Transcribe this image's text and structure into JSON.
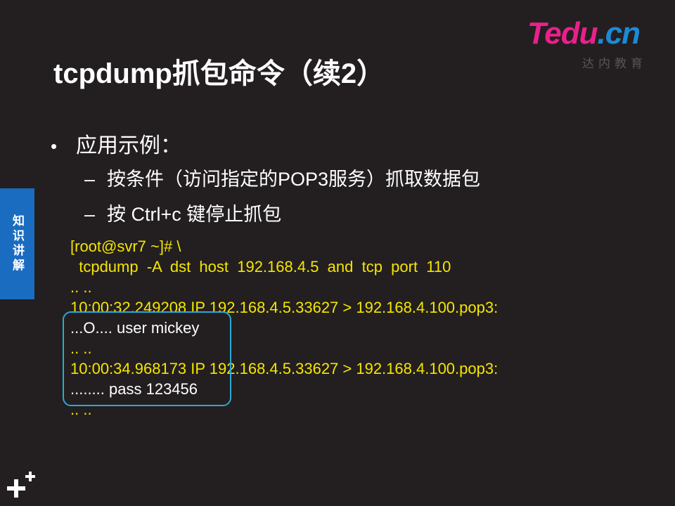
{
  "logo": {
    "brand": "Tedu",
    "tld": ".cn",
    "subtitle": "达内教育"
  },
  "slide": {
    "title": "tcpdump抓包命令（续2）",
    "side_tab_label": "知识讲解",
    "bullets": [
      {
        "marker": "•",
        "text": "应用示例：",
        "children": [
          {
            "marker": "–",
            "text": "按条件（访问指定的POP3服务）抓取数据包"
          },
          {
            "marker": "–",
            "text": "按 Ctrl+c 键停止抓包"
          }
        ]
      }
    ],
    "terminal_lines": [
      {
        "text": "[root@svr7 ~]# \\",
        "color": "#f5e600"
      },
      {
        "text": "  tcpdump  -A  dst  host  192.168.4.5  and  tcp  port  110",
        "color": "#f5e600"
      },
      {
        "text": ".. ..",
        "color": "#f5e600"
      },
      {
        "text": "10:00:32.249208 IP 192.168.4.5.33627 > 192.168.4.100.pop3:",
        "color": "#f5e600"
      },
      {
        "text": "...O.... user mickey",
        "color": "#ffffff"
      },
      {
        "text": ".. ..",
        "color": "#f5e600"
      },
      {
        "text": "10:00:34.968173 IP 192.168.4.5.33627 > 192.168.4.100.pop3:",
        "color": "#f5e600"
      },
      {
        "text": "........ pass 123456",
        "color": "#ffffff"
      },
      {
        "text": ".. ..",
        "color": "#f5e600"
      }
    ]
  },
  "icons": {
    "corner": "plus-cluster-icon"
  },
  "colors": {
    "background": "#231f20",
    "terminal_text": "#f5e600",
    "highlight_border": "#2ba8d8",
    "side_tab": "#1a6cc0",
    "logo_pink": "#e8218a",
    "logo_blue": "#1c8ad6"
  }
}
